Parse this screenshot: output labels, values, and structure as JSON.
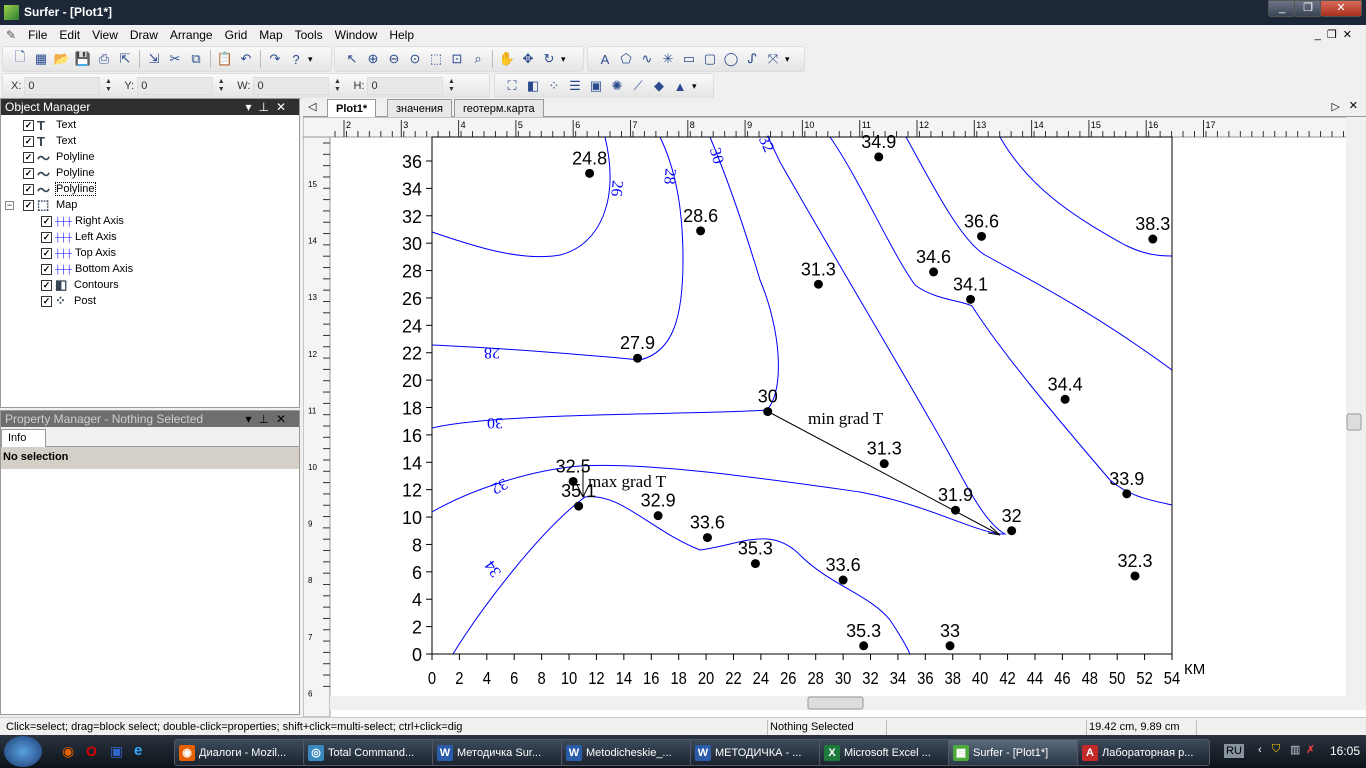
{
  "window": {
    "title": "Surfer - [Plot1*]",
    "controls": [
      "_",
      "❐",
      "✕"
    ],
    "doc_controls": [
      "_",
      "❐",
      "✕"
    ]
  },
  "menu": [
    "File",
    "Edit",
    "View",
    "Draw",
    "Arrange",
    "Grid",
    "Map",
    "Tools",
    "Window",
    "Help"
  ],
  "toolbar": {
    "standard": [
      "new-icon",
      "new-worksheet-icon",
      "open-icon",
      "save-icon",
      "print-icon",
      "export-icon",
      "import-icon",
      "cut-icon",
      "copy-icon",
      "paste-icon",
      "undo-icon",
      "redo-icon",
      "help-icon"
    ],
    "view": [
      "select-icon",
      "zoom-in-icon",
      "zoom-out-icon",
      "zoom-page-icon",
      "zoom-rect-icon",
      "zoom-selected-icon",
      "zoom-actual-icon",
      "pan-icon",
      "move-icon",
      "rotate-icon"
    ],
    "draw": [
      "text-icon",
      "polygon-icon",
      "polyline-icon",
      "symbol-icon",
      "rectangle-icon",
      "rounded-rectangle-icon",
      "ellipse-icon",
      "spline-icon",
      "reshape-icon"
    ],
    "map": [
      "base-map-icon",
      "contour-map-icon",
      "post-map-icon",
      "classed-post-icon",
      "image-map-icon",
      "vector-map-icon",
      "shaded-relief-icon",
      "3d-surface-icon",
      "3d-wireframe-icon"
    ]
  },
  "coords": {
    "x_label": "X:",
    "x": "0",
    "y_label": "Y:",
    "y": "0",
    "w_label": "W:",
    "w": "0",
    "h_label": "H:",
    "h": "0"
  },
  "object_manager": {
    "title": "Object Manager",
    "items": [
      {
        "label": "Text",
        "icon": "text-icon"
      },
      {
        "label": "Text",
        "icon": "text-icon"
      },
      {
        "label": "Polyline",
        "icon": "polyline-icon"
      },
      {
        "label": "Polyline",
        "icon": "polyline-icon"
      },
      {
        "label": "Polyline",
        "icon": "polyline-icon"
      },
      {
        "label": "Map",
        "icon": "map-frame-icon"
      },
      {
        "label": "Right Axis",
        "icon": "axis-icon"
      },
      {
        "label": "Left Axis",
        "icon": "axis-icon"
      },
      {
        "label": "Top Axis",
        "icon": "axis-icon"
      },
      {
        "label": "Bottom Axis",
        "icon": "axis-icon"
      },
      {
        "label": "Contours",
        "icon": "contour-map-icon"
      },
      {
        "label": "Post",
        "icon": "post-map-icon"
      }
    ]
  },
  "property_manager": {
    "title": "Property Manager - Nothing Selected",
    "tab": "Info",
    "content": "No selection"
  },
  "tabs": [
    "Plot1*",
    "значения",
    "геотерм.карта"
  ],
  "rulers": {
    "top": [
      "2",
      "3",
      "4",
      "5",
      "6",
      "7",
      "8",
      "9",
      "10",
      "11",
      "12",
      "13",
      "14",
      "15",
      "16",
      "17"
    ],
    "left": [
      "15",
      "14",
      "13",
      "12",
      "11",
      "10",
      "9",
      "8",
      "7",
      "6"
    ]
  },
  "map": {
    "x_unit": "КМ",
    "x_ticks": [
      0,
      2,
      4,
      6,
      8,
      10,
      12,
      14,
      16,
      18,
      20,
      22,
      24,
      26,
      28,
      30,
      32,
      34,
      36,
      38,
      40,
      42,
      44,
      46,
      48,
      50,
      52,
      54
    ],
    "y_ticks": [
      0,
      2,
      4,
      6,
      8,
      10,
      12,
      14,
      16,
      18,
      20,
      22,
      24,
      26,
      28,
      30,
      32,
      34,
      36
    ],
    "xlim": [
      0,
      54
    ],
    "ylim": [
      0,
      37.8
    ],
    "contour_color": "#0000ff",
    "contour_labels": [
      "26",
      "28",
      "30",
      "32",
      "28",
      "30",
      "32",
      "34"
    ],
    "points": [
      {
        "x": 11.5,
        "y": 35.1,
        "v": "24.8"
      },
      {
        "x": 19.6,
        "y": 30.9,
        "v": "28.6"
      },
      {
        "x": 32.6,
        "y": 36.3,
        "v": "34.9"
      },
      {
        "x": 40.1,
        "y": 30.5,
        "v": "36.6"
      },
      {
        "x": 52.6,
        "y": 30.3,
        "v": "38.3"
      },
      {
        "x": 36.6,
        "y": 27.9,
        "v": "34.6"
      },
      {
        "x": 39.3,
        "y": 25.9,
        "v": "34.1"
      },
      {
        "x": 28.2,
        "y": 27.0,
        "v": "31.3"
      },
      {
        "x": 15.0,
        "y": 21.6,
        "v": "27.9"
      },
      {
        "x": 24.5,
        "y": 17.7,
        "v": "30"
      },
      {
        "x": 46.2,
        "y": 18.6,
        "v": "34.4"
      },
      {
        "x": 33.0,
        "y": 13.9,
        "v": "31.3"
      },
      {
        "x": 10.3,
        "y": 12.6,
        "v": "32.5"
      },
      {
        "x": 10.7,
        "y": 10.8,
        "v": "35.1"
      },
      {
        "x": 16.5,
        "y": 10.1,
        "v": "32.9"
      },
      {
        "x": 20.1,
        "y": 8.5,
        "v": "33.6"
      },
      {
        "x": 23.6,
        "y": 6.6,
        "v": "35.3"
      },
      {
        "x": 30.0,
        "y": 5.4,
        "v": "33.6"
      },
      {
        "x": 38.2,
        "y": 10.5,
        "v": "31.9"
      },
      {
        "x": 42.3,
        "y": 9.0,
        "v": "32"
      },
      {
        "x": 50.7,
        "y": 11.7,
        "v": "33.9"
      },
      {
        "x": 51.3,
        "y": 5.7,
        "v": "32.3"
      },
      {
        "x": 31.5,
        "y": 0.6,
        "v": "35.3"
      },
      {
        "x": 37.8,
        "y": 0.6,
        "v": "33"
      }
    ],
    "annotations": {
      "min": "min grad T",
      "max": "max grad T"
    }
  },
  "status": {
    "hint": "Click=select; drag=block select; double-click=properties; shift+click=multi-select; ctrl+click=dig",
    "selection": "Nothing Selected",
    "position": "19.42 cm, 9.89 cm"
  },
  "taskbar": {
    "items": [
      {
        "label": "Диалоги - Mozil...",
        "color": "#e66000",
        "g": "◉"
      },
      {
        "label": "Total Command...",
        "color": "#3a8ac0",
        "g": "◎"
      },
      {
        "label": "Методичка Sur...",
        "color": "#2b5caa",
        "g": "W"
      },
      {
        "label": "Metodicheskie_...",
        "color": "#2b5caa",
        "g": "W"
      },
      {
        "label": "МЕТОДИЧКА - ...",
        "color": "#2b5caa",
        "g": "W"
      },
      {
        "label": "Microsoft Excel ...",
        "color": "#1e7a3c",
        "g": "X"
      },
      {
        "label": "Surfer - [Plot1*]",
        "color": "#4caa3c",
        "g": "▦"
      },
      {
        "label": "Лабораторная р...",
        "color": "#c62828",
        "g": "A"
      }
    ],
    "lang": "RU",
    "clock": "16:05"
  }
}
